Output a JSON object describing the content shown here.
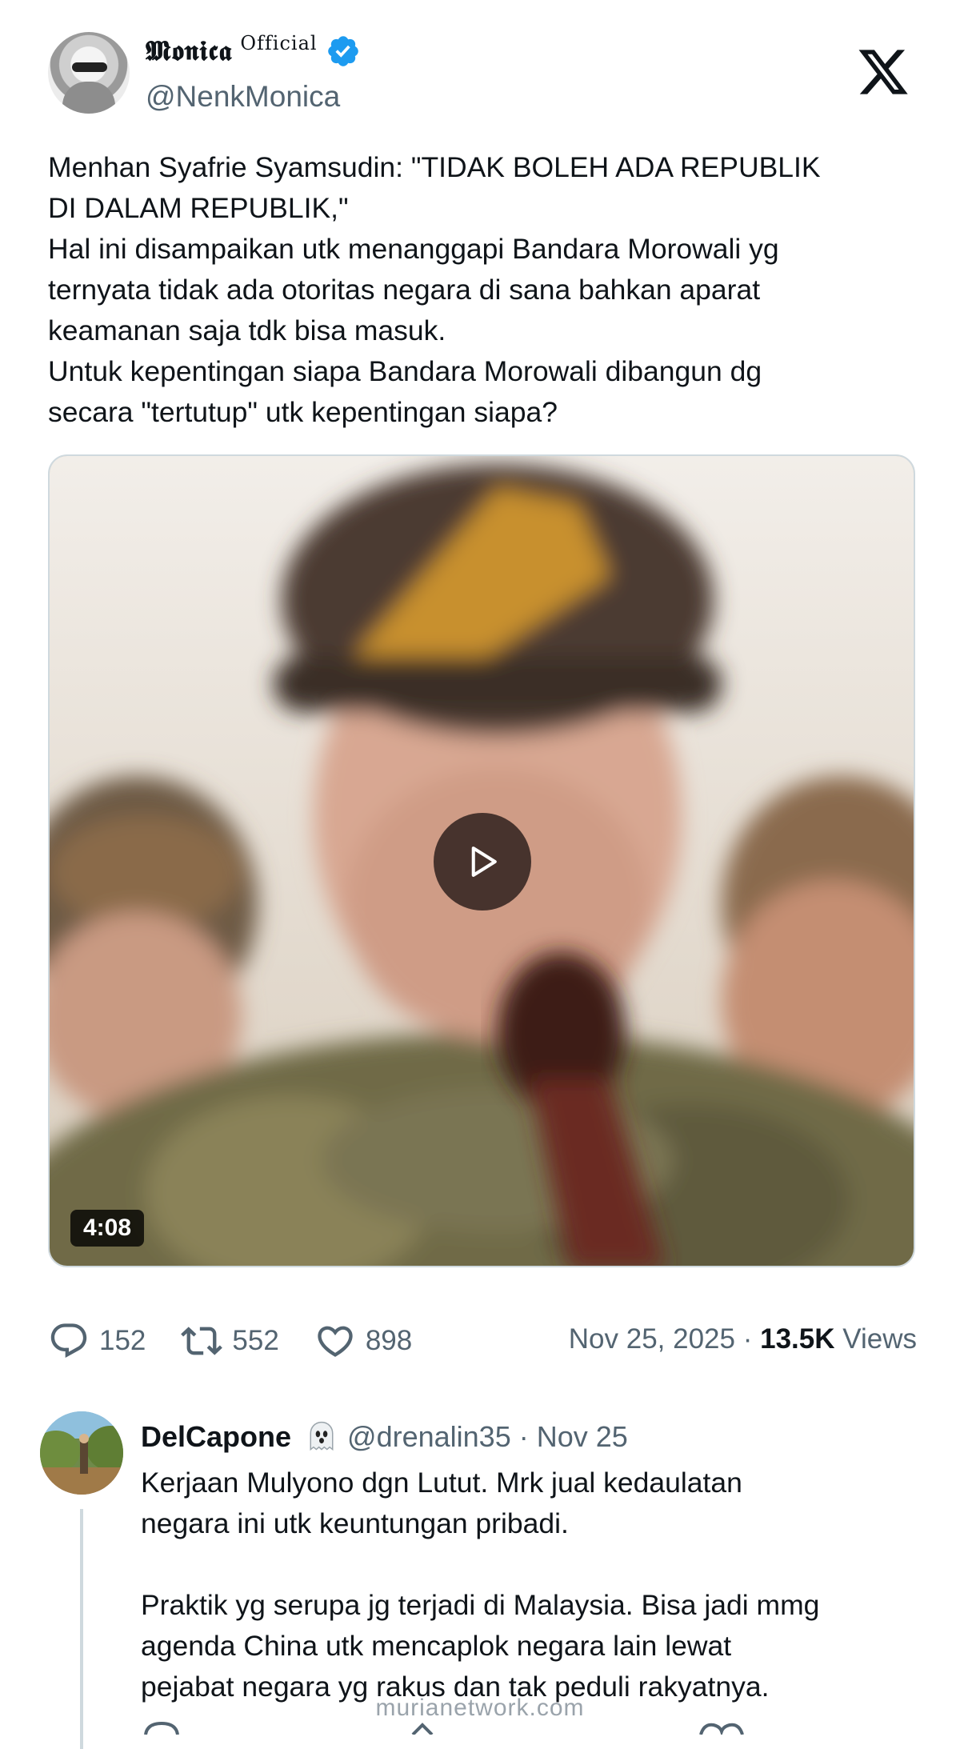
{
  "author": {
    "display_name": "𝕸𝖔𝖓𝖎𝖈𝖆",
    "official_tag": "Official",
    "handle": "@NenkMonica",
    "verified_color": "#1d9bf0"
  },
  "platform_logo": "x-logo-icon",
  "tweet": {
    "lines": [
      "Menhan Syafrie Syamsudin: \"TIDAK BOLEH ADA REPUBLIK",
      "DI DALAM REPUBLIK,\"",
      "Hal ini disampaikan utk menanggapi Bandara Morowali yg",
      "ternyata tidak ada otoritas negara di sana bahkan aparat",
      "keamanan saja tdk bisa masuk.",
      "Untuk kepentingan siapa Bandara Morowali dibangun dg",
      "secara \"tertutup\" utk kepentingan siapa?"
    ]
  },
  "video": {
    "duration": "4:08",
    "icon": "play-icon"
  },
  "stats": {
    "replies": "152",
    "reposts": "552",
    "likes": "898",
    "date": "Nov 25, 2025",
    "separator": "·",
    "views_count": "13.5K",
    "views_label": "Views"
  },
  "reply": {
    "name": "DelCapone",
    "handle_time": "@drenalin35 · Nov 25",
    "lines": [
      "Kerjaan Mulyono dgn Lutut. Mrk jual kedaulatan",
      "negara ini utk keuntungan pribadi.",
      "",
      "Praktik yg serupa jg terjadi di Malaysia. Bisa jadi mmg",
      "agenda China utk mencaplok negara lain lewat",
      "pejabat negara yg rakus dan tak peduli rakyatnya."
    ]
  },
  "watermark": "murianetwork.com",
  "colors": {
    "text_primary": "#0f1419",
    "text_secondary": "#536471",
    "border": "#cfd9de"
  }
}
